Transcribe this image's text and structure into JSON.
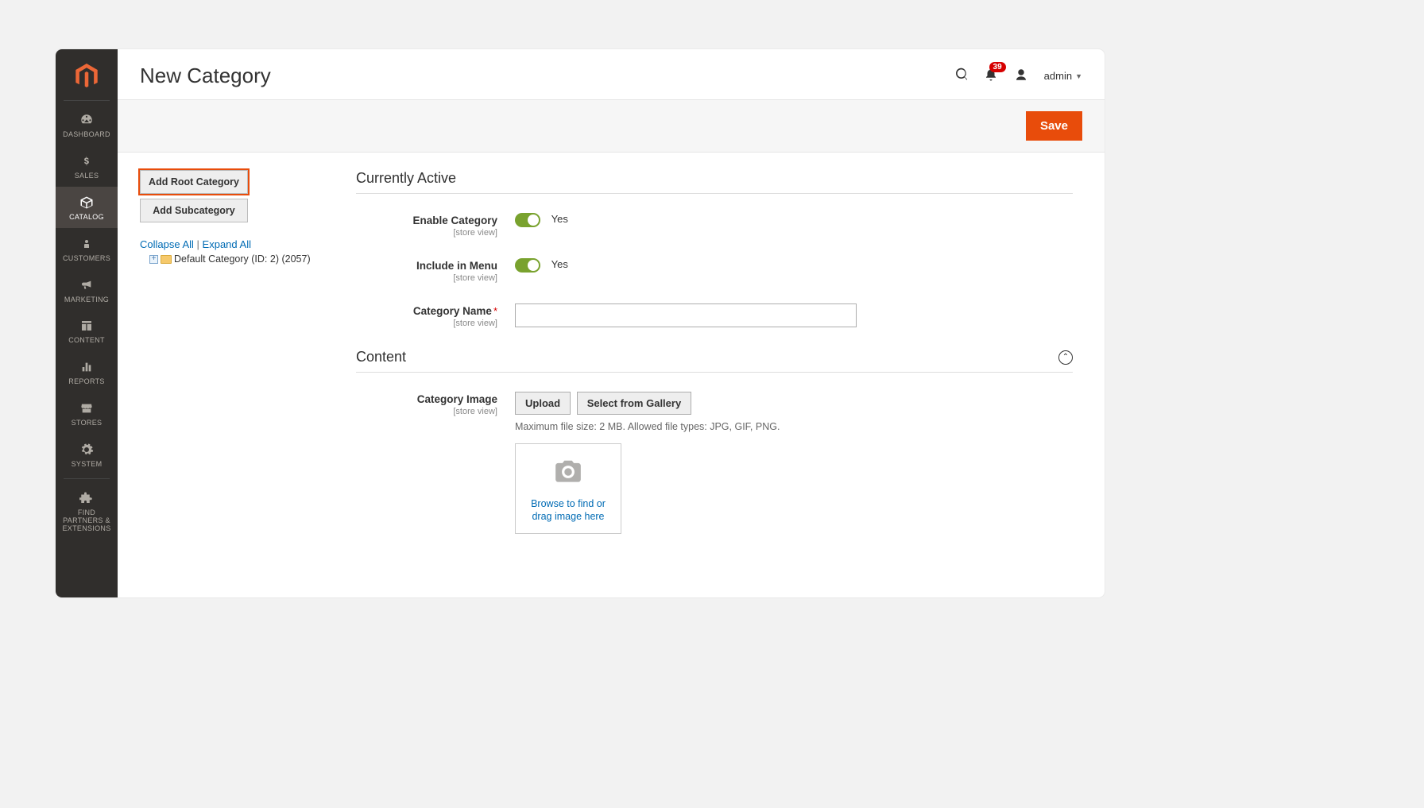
{
  "header": {
    "title": "New Category",
    "notifications_count": "39",
    "admin_label": "admin"
  },
  "actionbar": {
    "save_label": "Save"
  },
  "sidebar": {
    "items": [
      {
        "label": "DASHBOARD"
      },
      {
        "label": "SALES"
      },
      {
        "label": "CATALOG"
      },
      {
        "label": "CUSTOMERS"
      },
      {
        "label": "MARKETING"
      },
      {
        "label": "CONTENT"
      },
      {
        "label": "REPORTS"
      },
      {
        "label": "STORES"
      },
      {
        "label": "SYSTEM"
      },
      {
        "label": "FIND PARTNERS & EXTENSIONS"
      }
    ]
  },
  "tree": {
    "add_root_label": "Add Root Category",
    "add_sub_label": "Add Subcategory",
    "collapse_all": "Collapse All",
    "expand_all": "Expand All",
    "separator": " | ",
    "root_node": "Default Category (ID: 2) (2057)"
  },
  "sections": {
    "active": {
      "title": "Currently Active",
      "enable_label": "Enable Category",
      "enable_scope": "[store view]",
      "enable_value": "Yes",
      "menu_label": "Include in Menu",
      "menu_scope": "[store view]",
      "menu_value": "Yes",
      "name_label": "Category Name",
      "name_scope": "[store view]",
      "name_value": ""
    },
    "content": {
      "title": "Content",
      "image_label": "Category Image",
      "image_scope": "[store view]",
      "upload_label": "Upload",
      "gallery_label": "Select from Gallery",
      "helper": "Maximum file size: 2 MB. Allowed file types: JPG, GIF, PNG.",
      "dropzone_text": "Browse to find or drag image here"
    }
  }
}
